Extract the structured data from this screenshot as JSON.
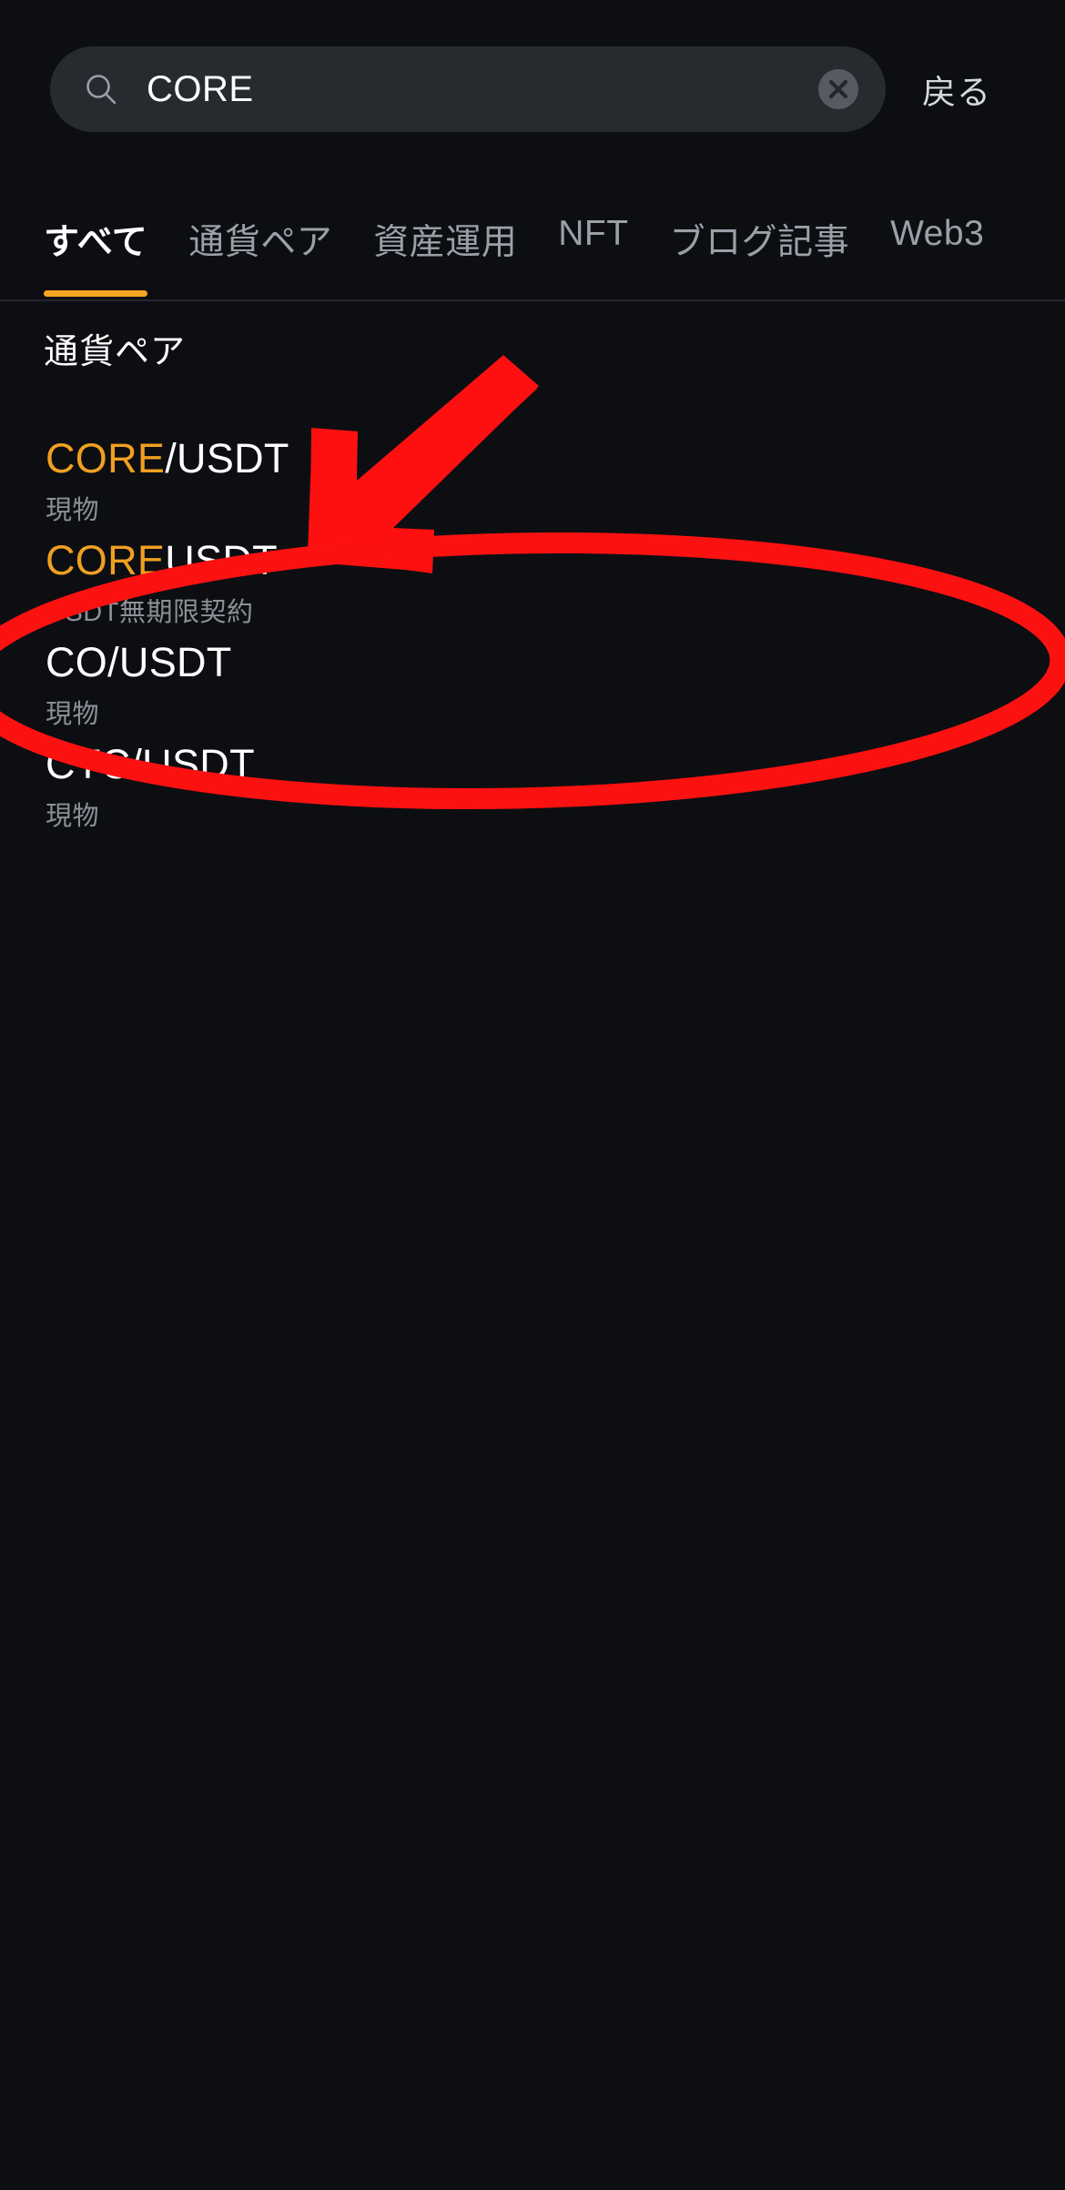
{
  "search": {
    "query": "CORE",
    "placeholder": "CORE",
    "icon": "search-icon",
    "clear_icon": "close-circle-icon",
    "back_label": "戻る"
  },
  "tabs": [
    {
      "label": "すべて",
      "active": true
    },
    {
      "label": "通貨ペア",
      "active": false
    },
    {
      "label": "資産運用",
      "active": false
    },
    {
      "label": "NFT",
      "active": false
    },
    {
      "label": "ブログ記事",
      "active": false
    },
    {
      "label": "Web3",
      "active": false
    }
  ],
  "section": {
    "title": "通貨ペア"
  },
  "results": [
    {
      "highlight": "CORE",
      "rest": "/USDT",
      "sub": "現物"
    },
    {
      "highlight": "CORE",
      "rest": "USDT",
      "sub": "USDT無期限契約"
    },
    {
      "highlight": "",
      "rest": "CO/USDT",
      "sub": "現物"
    },
    {
      "highlight": "",
      "rest": "CTC/USDT",
      "sub": "現物"
    }
  ],
  "annotations": {
    "arrow_color": "#ff1010",
    "ellipse_color": "#fc1111",
    "arrow_target": "second-result-item",
    "ellipse_target": "second-result-item"
  },
  "colors": {
    "background": "#0d0e12",
    "search_field": "#272b30",
    "accent": "#f5a623",
    "highlight_text": "#f0a020",
    "primary_text": "#ffffff",
    "secondary_text": "#8b9097",
    "muted_text": "#9aa0a8",
    "annotation_red": "#ff1010"
  }
}
